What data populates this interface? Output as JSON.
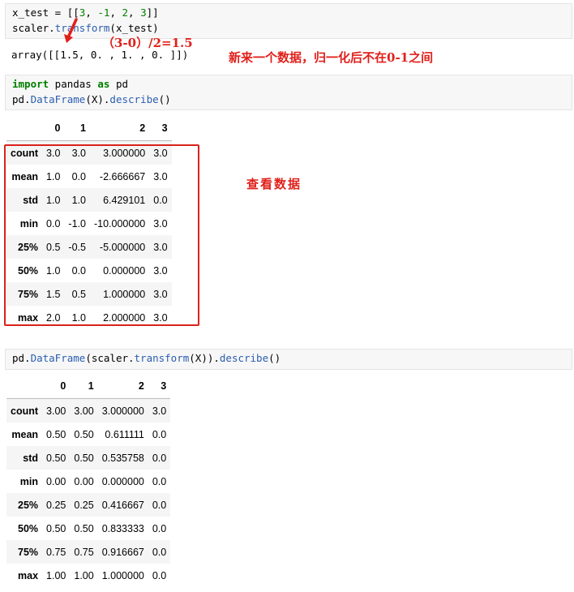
{
  "cell1": {
    "line1": "x_test = [[3, -1, 2, 3]]",
    "line2": "scaler.transform(x_test)"
  },
  "output1": "array([[1.5, 0. , 1. , 0. ]])",
  "annotations": {
    "formula": "（3-0）/2=1.5",
    "note": "新来一个数据，归一化后不在0-1之间",
    "view_data": "查看数据"
  },
  "cell2": {
    "line1": "import pandas as pd",
    "line2": "pd.DataFrame(X).describe()"
  },
  "table1": {
    "columns": [
      "",
      "0",
      "1",
      "2",
      "3"
    ],
    "rows": [
      {
        "label": "count",
        "v": [
          "3.0",
          "3.0",
          "3.000000",
          "3.0"
        ]
      },
      {
        "label": "mean",
        "v": [
          "1.0",
          "0.0",
          "-2.666667",
          "3.0"
        ]
      },
      {
        "label": "std",
        "v": [
          "1.0",
          "1.0",
          "6.429101",
          "0.0"
        ]
      },
      {
        "label": "min",
        "v": [
          "0.0",
          "-1.0",
          "-10.000000",
          "3.0"
        ]
      },
      {
        "label": "25%",
        "v": [
          "0.5",
          "-0.5",
          "-5.000000",
          "3.0"
        ]
      },
      {
        "label": "50%",
        "v": [
          "1.0",
          "0.0",
          "0.000000",
          "3.0"
        ]
      },
      {
        "label": "75%",
        "v": [
          "1.5",
          "0.5",
          "1.000000",
          "3.0"
        ]
      },
      {
        "label": "max",
        "v": [
          "2.0",
          "1.0",
          "2.000000",
          "3.0"
        ]
      }
    ]
  },
  "cell3": {
    "line1": "pd.DataFrame(scaler.transform(X)).describe()"
  },
  "table2": {
    "columns": [
      "",
      "0",
      "1",
      "2",
      "3"
    ],
    "rows": [
      {
        "label": "count",
        "v": [
          "3.00",
          "3.00",
          "3.000000",
          "3.0"
        ]
      },
      {
        "label": "mean",
        "v": [
          "0.50",
          "0.50",
          "0.611111",
          "0.0"
        ]
      },
      {
        "label": "std",
        "v": [
          "0.50",
          "0.50",
          "0.535758",
          "0.0"
        ]
      },
      {
        "label": "min",
        "v": [
          "0.00",
          "0.00",
          "0.000000",
          "0.0"
        ]
      },
      {
        "label": "25%",
        "v": [
          "0.25",
          "0.25",
          "0.416667",
          "0.0"
        ]
      },
      {
        "label": "50%",
        "v": [
          "0.50",
          "0.50",
          "0.833333",
          "0.0"
        ]
      },
      {
        "label": "75%",
        "v": [
          "0.75",
          "0.75",
          "0.916667",
          "0.0"
        ]
      },
      {
        "label": "max",
        "v": [
          "1.00",
          "1.00",
          "1.000000",
          "0.0"
        ]
      }
    ]
  }
}
